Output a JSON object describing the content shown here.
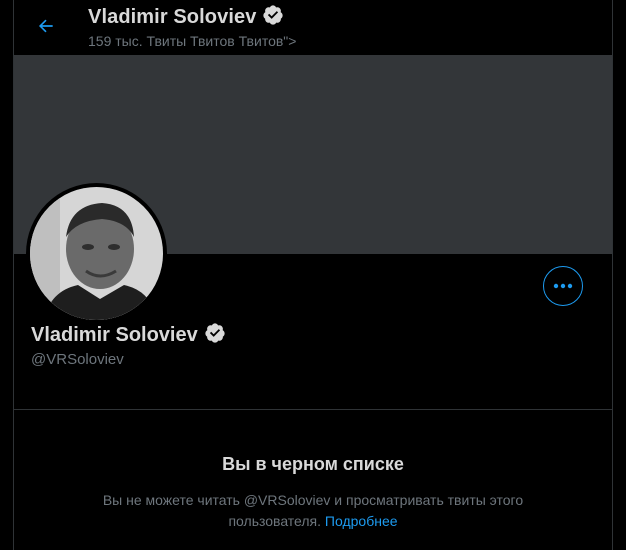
{
  "header": {
    "name": "Vladimir Soloviev",
    "subtitle": "159 тыс. Твиты Твитов Твитов\">"
  },
  "profile": {
    "name": "Vladimir Soloviev",
    "handle": "@VRSoloviev"
  },
  "blocked": {
    "title": "Вы в черном списке",
    "message_part1": "Вы не можете читать @VRSoloviev и просматривать твиты этого",
    "message_part2": "пользователя.",
    "learn_more": "Подробнее"
  },
  "icons": {
    "back": "back-arrow-icon",
    "verified": "verified-badge-icon",
    "more": "more-options-icon"
  },
  "colors": {
    "accent": "#1d9bf0",
    "background": "#000000",
    "banner": "#333639",
    "muted_text": "#6e767d",
    "primary_text": "#d9d9d9"
  }
}
